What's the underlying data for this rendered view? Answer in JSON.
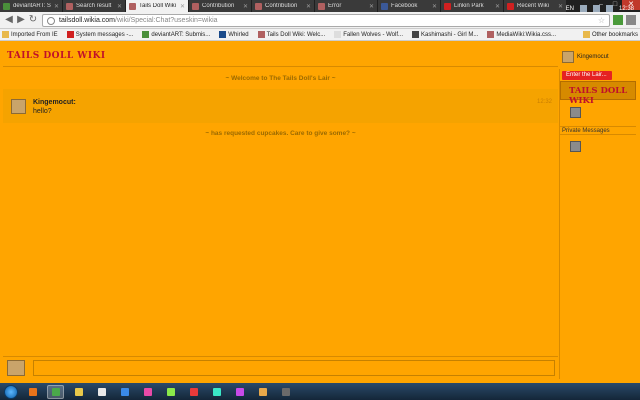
{
  "browser": {
    "tabs": [
      {
        "title": "deviantART: S",
        "favicon_color": "#4a8f3a",
        "active": false
      },
      {
        "title": "Search result",
        "favicon_color": "#b06060",
        "active": false
      },
      {
        "title": "Tails Doll Wiki",
        "favicon_color": "#b06060",
        "active": true
      },
      {
        "title": "Contribution",
        "favicon_color": "#b06060",
        "active": false
      },
      {
        "title": "Contribution",
        "favicon_color": "#b06060",
        "active": false
      },
      {
        "title": "Error",
        "favicon_color": "#b06060",
        "active": false
      },
      {
        "title": "Facebook",
        "favicon_color": "#3b5998",
        "active": false
      },
      {
        "title": "Linkin Park",
        "favicon_color": "#d02020",
        "active": false
      },
      {
        "title": "Recent Wiki",
        "favicon_color": "#d02020",
        "active": false
      }
    ],
    "url_host": "tailsdoll.wikia.com",
    "url_path": "/wiki/Special:Chat?useskin=wikia",
    "bookmarks": [
      {
        "label": "Imported From IE",
        "icon_color": "#e8b84a"
      },
      {
        "label": "System messages -...",
        "icon_color": "#d02020"
      },
      {
        "label": "deviantART: Submis...",
        "icon_color": "#4a8f3a"
      },
      {
        "label": "Whirled",
        "icon_color": "#1a4a8a"
      },
      {
        "label": "Tails Doll Wiki: Welc...",
        "icon_color": "#b06060"
      },
      {
        "label": "Fallen Wolves - Wolf...",
        "icon_color": "#dddddd"
      },
      {
        "label": "Kashimashi - Girl M...",
        "icon_color": "#444444"
      },
      {
        "label": "MediaWiki:Wikia.css...",
        "icon_color": "#b06060"
      }
    ],
    "other_bookmarks": "Other bookmarks"
  },
  "chat": {
    "wiki_logo": "TAILS DOLL WIKI",
    "current_user": "Kingemocut",
    "welcome": "~ Welcome to The Tails Doll's Lair ~",
    "messages": [
      {
        "user": "Kingemocut:",
        "text": "hello?",
        "time": "12:32"
      }
    ],
    "notice": "~ has requested cupcakes. Care to give some? ~",
    "room_button": "Enter the Lair...",
    "room_logo": "TAILS DOLL WIKI",
    "private_messages": "Private Messages",
    "input_value": ""
  },
  "taskbar": {
    "apps": [
      {
        "name": "firefox",
        "color": "#e8731a"
      },
      {
        "name": "chrome",
        "color": "#4aa84a",
        "active": true
      },
      {
        "name": "explorer",
        "color": "#e8c84a"
      },
      {
        "name": "media",
        "color": "#e8e8e8"
      },
      {
        "name": "media-player",
        "color": "#3a8ae8"
      },
      {
        "name": "paint",
        "color": "#e84aa8"
      },
      {
        "name": "app7",
        "color": "#8ae84a"
      },
      {
        "name": "app8",
        "color": "#e83a3a"
      },
      {
        "name": "app9",
        "color": "#3ae8c8"
      },
      {
        "name": "app10",
        "color": "#c84ae8"
      },
      {
        "name": "app11",
        "color": "#e8a84a"
      },
      {
        "name": "app12",
        "color": "#6a6a6a"
      }
    ],
    "language": "EN",
    "clock": "12:38"
  }
}
